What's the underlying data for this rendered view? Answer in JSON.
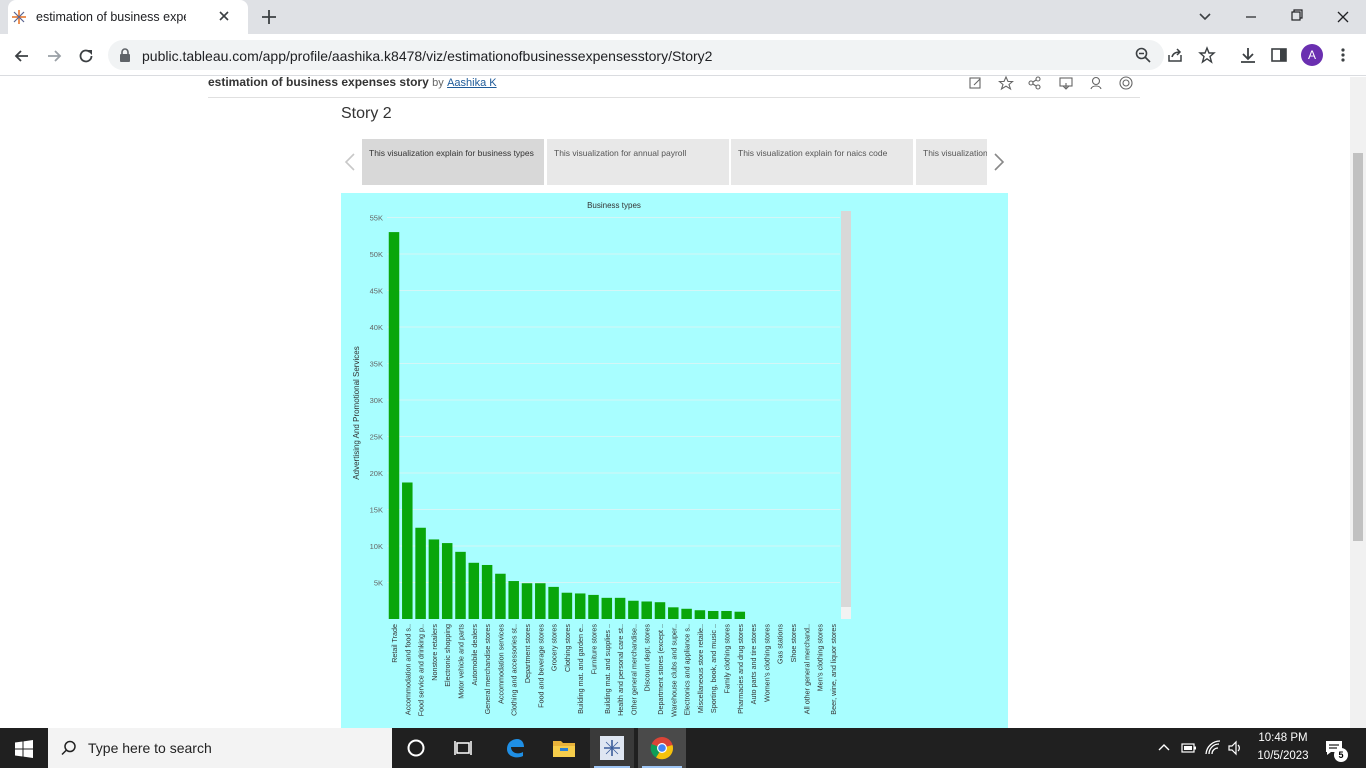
{
  "browser": {
    "tab_title": "estimation of business expenses",
    "url": "public.tableau.com/app/profile/aashika.k8478/viz/estimationofbusinessexpensesstory/Story2",
    "avatar_letter": "A"
  },
  "page": {
    "viz_title": "estimation of business expenses story",
    "by_label": "by",
    "author": "Aashika K",
    "story_title": "Story 2",
    "story_points": [
      "This visualization explain for business types",
      "This visualization for  annual payroll",
      "This visualization explain for naics code",
      "This visualization"
    ]
  },
  "colors": {
    "viz_background": "#a8feff",
    "bar": "#09a60b",
    "story_active": "#d8d8d8",
    "story_inactive": "#e8e8e8"
  },
  "chart_data": {
    "type": "bar",
    "title": "Business types",
    "xlabel": "",
    "ylabel": "Advertising And Promotional Services",
    "ylim": [
      0,
      55000
    ],
    "yticks": [
      "5K",
      "10K",
      "15K",
      "20K",
      "25K",
      "30K",
      "35K",
      "40K",
      "45K",
      "50K",
      "55K"
    ],
    "grid": true,
    "categories": [
      "Retail Trade",
      "Accommodation and food s..",
      "Food service and drinking p..",
      "Nonstore retailers",
      "Electronic shopping",
      "Motor vehicle and parts",
      "Automobile dealers",
      "General merchandise stores",
      "Accommodation services",
      "Clothing and accessories st..",
      "Department stores",
      "Food and beverage stores",
      "Grocery stores",
      "Clothing stores",
      "Building mat. and garden e..",
      "Furniture stores",
      "Building mat. and supplies ..",
      "Health and personal care st..",
      "Other general merchandise..",
      "Discount dept. stores",
      "Department stores (except ..",
      "Warehouse clubs and super..",
      "Electronics and appliance s..",
      "Miscellaneous store retaile..",
      "Sporting, book, and music ..",
      "Family clothing stores",
      "Pharmacies and drug stores",
      "Auto parts and tire stores",
      "Women's clothing stores",
      "Gas stations",
      "Shoe stores",
      "All other general merchand..",
      "Men's clothing stores",
      "Beer, wine, and liquor stores"
    ],
    "values": [
      53000,
      18700,
      12500,
      10900,
      10400,
      9200,
      7700,
      7400,
      6200,
      5200,
      4900,
      4900,
      4400,
      3600,
      3500,
      3300,
      2900,
      2900,
      2500,
      2400,
      2300,
      1600,
      1400,
      1200,
      1100,
      1100,
      1000,
      0,
      0,
      0,
      0,
      0,
      0,
      0
    ]
  },
  "taskbar": {
    "search_placeholder": "Type here to search",
    "time": "10:48 PM",
    "date": "10/5/2023",
    "notification_count": "5"
  }
}
